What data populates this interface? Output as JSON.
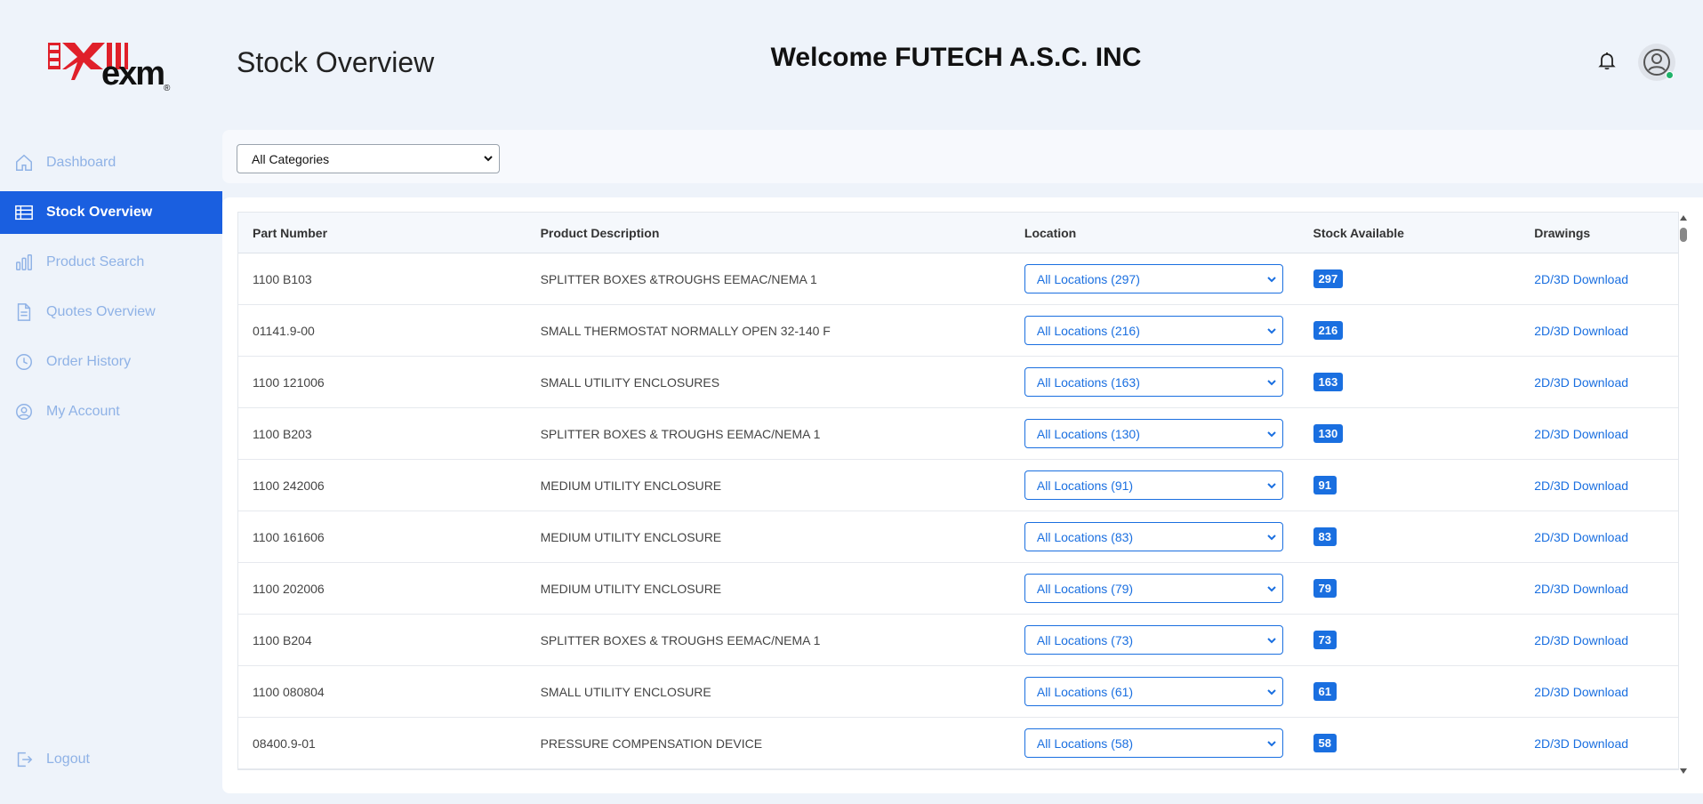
{
  "brand": {
    "logo_text": "exm",
    "logo_reg": "®",
    "accent": "#1a5fe0",
    "logo_red": "#e0202a"
  },
  "header": {
    "page_title": "Stock Overview",
    "welcome": "Welcome FUTECH A.S.C. INC",
    "bell_icon": "bell-icon",
    "avatar_icon": "user-circle-icon"
  },
  "sidebar": {
    "items": [
      {
        "label": "Dashboard",
        "icon": "home-icon",
        "active": false
      },
      {
        "label": "Stock Overview",
        "icon": "table-icon",
        "active": true
      },
      {
        "label": "Product Search",
        "icon": "bar-chart-icon",
        "active": false
      },
      {
        "label": "Quotes Overview",
        "icon": "document-icon",
        "active": false
      },
      {
        "label": "Order History",
        "icon": "clock-icon",
        "active": false
      },
      {
        "label": "My Account",
        "icon": "user-circle-icon",
        "active": false
      }
    ],
    "logout": "Logout"
  },
  "filter": {
    "category_selected": "All Categories"
  },
  "table": {
    "headers": [
      "Part Number",
      "Product Description",
      "Location",
      "Stock Available",
      "Drawings"
    ],
    "rows": [
      {
        "part": "1100 B103",
        "desc": "SPLITTER BOXES &TROUGHS EEMAC/NEMA 1",
        "location": "All Locations (297)",
        "stock": "297",
        "drawing": "2D/3D Download"
      },
      {
        "part": "01141.9-00",
        "desc": "SMALL THERMOSTAT NORMALLY OPEN 32-140 F",
        "location": "All Locations (216)",
        "stock": "216",
        "drawing": "2D/3D Download"
      },
      {
        "part": "1100 121006",
        "desc": "SMALL UTILITY ENCLOSURES",
        "location": "All Locations (163)",
        "stock": "163",
        "drawing": "2D/3D Download"
      },
      {
        "part": "1100 B203",
        "desc": "SPLITTER BOXES & TROUGHS EEMAC/NEMA 1",
        "location": "All Locations (130)",
        "stock": "130",
        "drawing": "2D/3D Download"
      },
      {
        "part": "1100 242006",
        "desc": "MEDIUM UTILITY ENCLOSURE",
        "location": "All Locations (91)",
        "stock": "91",
        "drawing": "2D/3D Download"
      },
      {
        "part": "1100 161606",
        "desc": "MEDIUM UTILITY ENCLOSURE",
        "location": "All Locations (83)",
        "stock": "83",
        "drawing": "2D/3D Download"
      },
      {
        "part": "1100 202006",
        "desc": "MEDIUM UTILITY ENCLOSURE",
        "location": "All Locations (79)",
        "stock": "79",
        "drawing": "2D/3D Download"
      },
      {
        "part": "1100 B204",
        "desc": "SPLITTER BOXES & TROUGHS EEMAC/NEMA 1",
        "location": "All Locations (73)",
        "stock": "73",
        "drawing": "2D/3D Download"
      },
      {
        "part": "1100 080804",
        "desc": "SMALL UTILITY ENCLOSURE",
        "location": "All Locations (61)",
        "stock": "61",
        "drawing": "2D/3D Download"
      },
      {
        "part": "08400.9-01",
        "desc": "PRESSURE COMPENSATION DEVICE",
        "location": "All Locations (58)",
        "stock": "58",
        "drawing": "2D/3D Download"
      }
    ]
  }
}
